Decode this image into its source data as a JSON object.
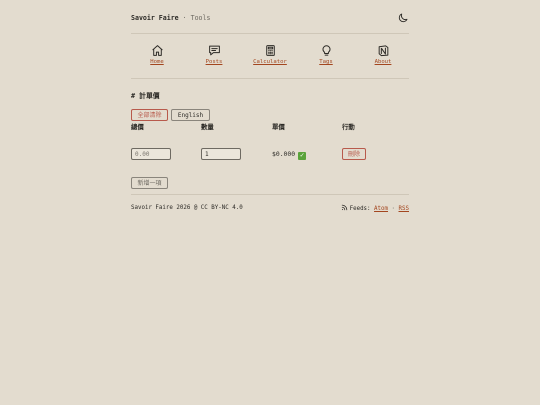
{
  "header": {
    "site": "Savoir Faire",
    "separator": "·",
    "section": "Tools"
  },
  "icons": {
    "theme": "moon-icon",
    "home": "home-icon",
    "posts": "chat-icon",
    "calculator": "calculator-icon",
    "tags": "lightbulb-icon",
    "about": "notion-icon",
    "feed": "rss-icon",
    "check": "check-icon"
  },
  "nav": {
    "home": "Home",
    "posts": "Posts",
    "calculator": "Calculator",
    "tags": "Tags",
    "about": "About"
  },
  "page": {
    "title": "# 計單價"
  },
  "actions": {
    "clear_all": "全部清除",
    "language": "English",
    "add_item": "新增一項"
  },
  "table": {
    "headers": {
      "total": "總價",
      "quantity": "數量",
      "unit_price": "單價",
      "action": "行動"
    },
    "rows": [
      {
        "total_placeholder": "0.00",
        "quantity_value": "1",
        "unit_price": "$0.000",
        "delete": "刪除"
      }
    ]
  },
  "footer": {
    "copyright": "Savoir Faire 2026 @ CC BY-NC 4.0",
    "feeds_label": "Feeds:",
    "atom": "Atom",
    "dot": "·",
    "rss": "RSS"
  },
  "colors": {
    "background": "#e3dccf",
    "accent": "#a3461f",
    "danger": "#b85a4c",
    "check": "#5aa33a"
  }
}
